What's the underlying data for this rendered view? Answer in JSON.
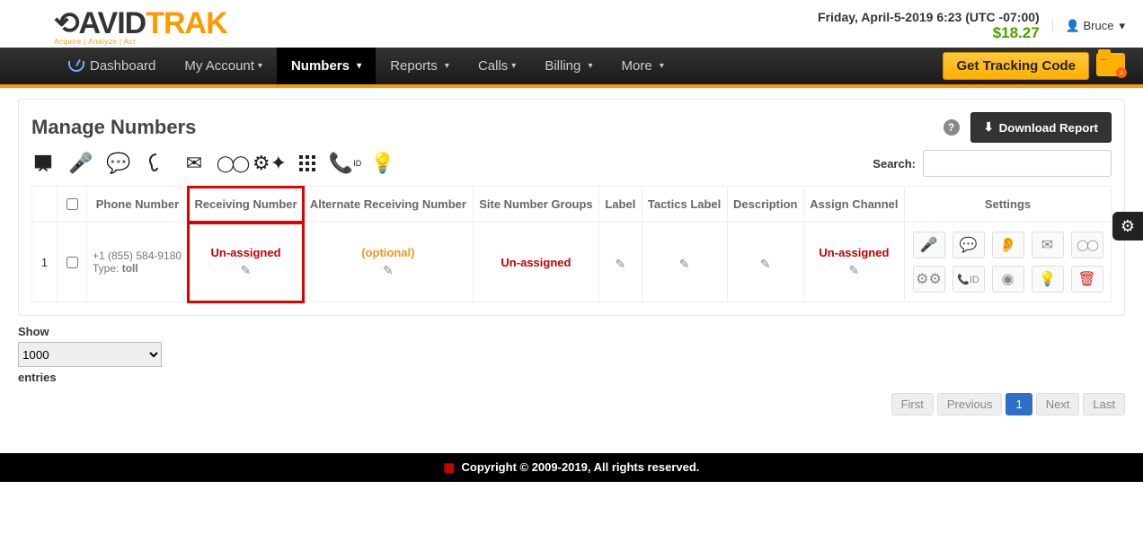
{
  "datetime": "Friday, April-5-2019 6:23 (UTC -07:00)",
  "balance": "$18.27",
  "user_name": "Bruce",
  "logo": {
    "brand1": "AVID",
    "brand2": "TRAK",
    "tagline": "Acquire | Analyze | Act"
  },
  "nav": {
    "dashboard": "Dashboard",
    "account": "My Account",
    "numbers": "Numbers",
    "reports": "Reports",
    "calls": "Calls",
    "billing": "Billing",
    "more": "More",
    "tracking_btn": "Get Tracking Code"
  },
  "page_title": "Manage Numbers",
  "download_btn": "Download Report",
  "search_label": "Search:",
  "columns": {
    "phone": "Phone Number",
    "recv": "Receiving Number",
    "alt": "Alternate Receiving Number",
    "groups": "Site Number Groups",
    "label": "Label",
    "tactics": "Tactics Label",
    "desc": "Description",
    "channel": "Assign Channel",
    "settings": "Settings"
  },
  "row": {
    "idx": "1",
    "phone": "+1 (855) 584-9180",
    "type_label": "Type:",
    "type_value": "toll",
    "recv": "Un-assigned",
    "alt": "(optional)",
    "groups": "Un-assigned",
    "channel": "Un-assigned"
  },
  "show_label": "Show",
  "entries_label": "entries",
  "show_value": "1000",
  "pager": {
    "first": "First",
    "prev": "Previous",
    "p1": "1",
    "next": "Next",
    "last": "Last"
  },
  "footer": "Copyright © 2009-2019, All rights reserved."
}
